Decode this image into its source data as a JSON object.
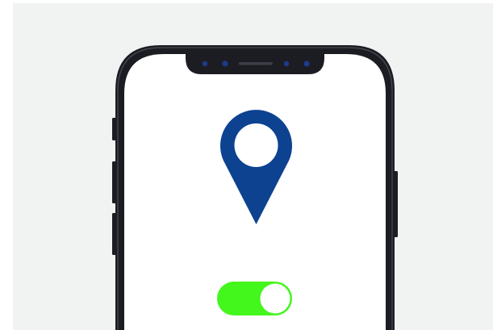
{
  "scene": {
    "backdrop_color": "#f1f3f3",
    "phone_body_color": "#1c1d22",
    "screen_color": "#ffffff",
    "icons": {
      "main": "map-pin-icon",
      "control": "toggle-switch"
    },
    "location_pin": {
      "icon": "map-pin-icon",
      "color": "#0d4291"
    },
    "location_toggle": {
      "state": "on",
      "track_color": "#43f61c",
      "knob_color": "#ffffff"
    }
  }
}
